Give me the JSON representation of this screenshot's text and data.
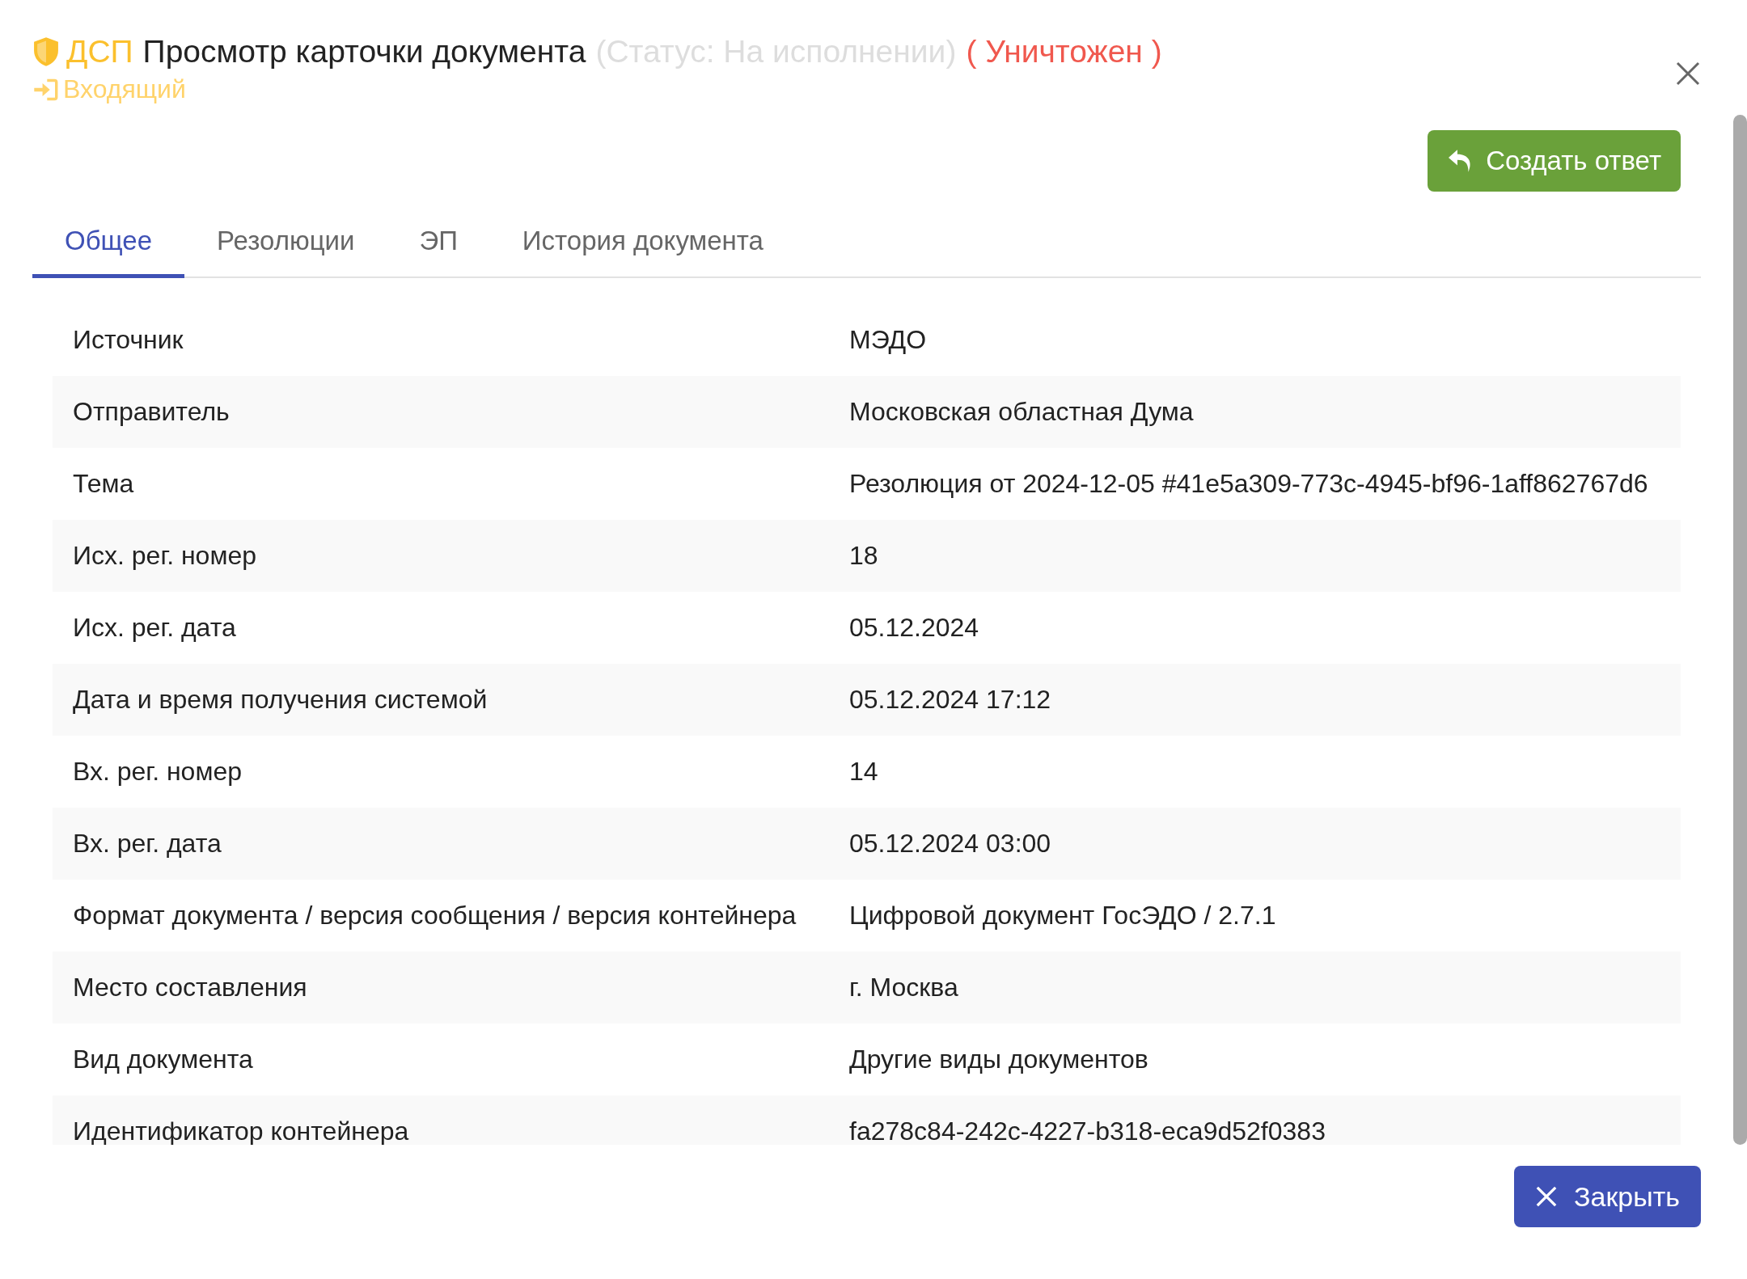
{
  "header": {
    "badge": "ДСП",
    "title": "Просмотр карточки документа",
    "status": "(Статус: На исполнении)",
    "destroyed": "( Уничтожен )",
    "direction": "Входящий"
  },
  "actions": {
    "reply": "Создать ответ"
  },
  "tabs": [
    {
      "label": "Общее",
      "selected": true
    },
    {
      "label": "Резолюции",
      "selected": false
    },
    {
      "label": "ЭП",
      "selected": false
    },
    {
      "label": "История документа",
      "selected": false
    }
  ],
  "fields": [
    {
      "label": "Источник",
      "value": "МЭДО"
    },
    {
      "label": "Отправитель",
      "value": "Московская областная Дума"
    },
    {
      "label": "Тема",
      "value": "Резолюция от 2024-12-05 #41e5a309-773c-4945-bf96-1aff862767d6"
    },
    {
      "label": "Исх. рег. номер",
      "value": "18"
    },
    {
      "label": "Исх. рег. дата",
      "value": "05.12.2024"
    },
    {
      "label": "Дата и время получения системой",
      "value": "05.12.2024 17:12"
    },
    {
      "label": "Вх. рег. номер",
      "value": "14"
    },
    {
      "label": "Вх. рег. дата",
      "value": "05.12.2024 03:00"
    },
    {
      "label": "Формат документа / версия сообщения / версия контейнера",
      "value": "Цифровой документ ГосЭДО / 2.7.1"
    },
    {
      "label": "Место составления",
      "value": "г. Москва"
    },
    {
      "label": "Вид документа",
      "value": "Другие виды документов"
    },
    {
      "label": "Идентификатор контейнера",
      "value": "fa278c84-242c-4227-b318-eca9d52f0383"
    }
  ],
  "footer": {
    "close": "Закрыть"
  }
}
